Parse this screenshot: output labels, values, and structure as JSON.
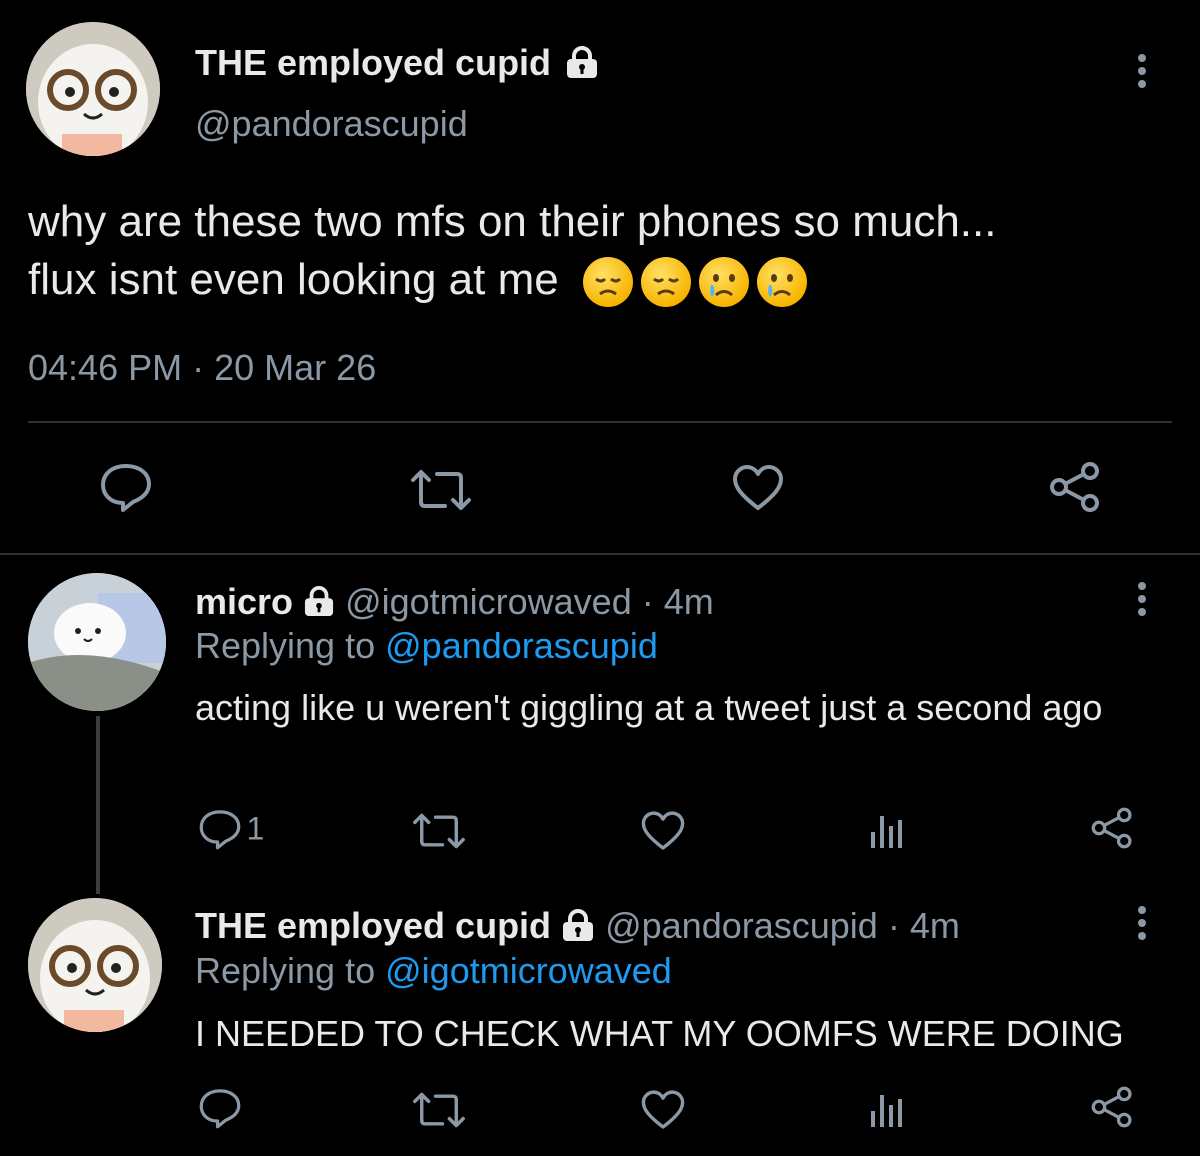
{
  "main_tweet": {
    "display_name": "THE employed cupid",
    "handle": "@pandorascupid",
    "text_line1": "why are these two mfs on their phones so much...",
    "text_line2": "flux isnt even looking at me",
    "emojis": [
      "disappointed-face",
      "disappointed-face",
      "crying-face",
      "crying-face"
    ],
    "time": "04:46 PM",
    "separator": "·",
    "date": "20 Mar 26"
  },
  "reply1": {
    "display_name": "micro",
    "handle": "@igotmicrowaved",
    "dot": "·",
    "age": "4m",
    "replying_prefix": "Replying to",
    "replying_to": "@pandorascupid",
    "text": "acting like u weren't giggling at a tweet just a second ago",
    "reply_count": "1"
  },
  "reply2": {
    "display_name": "THE employed cupid",
    "handle": "@pandorascupid",
    "dot": "·",
    "age": "4m",
    "replying_prefix": "Replying to",
    "replying_to": "@igotmicrowaved",
    "text": "I NEEDED TO CHECK WHAT MY OOMFS WERE DOING"
  },
  "colors": {
    "background": "#000000",
    "text": "#e7e9ea",
    "muted": "#8b98a5",
    "link": "#1d9bf0",
    "divider": "#2f3336"
  }
}
